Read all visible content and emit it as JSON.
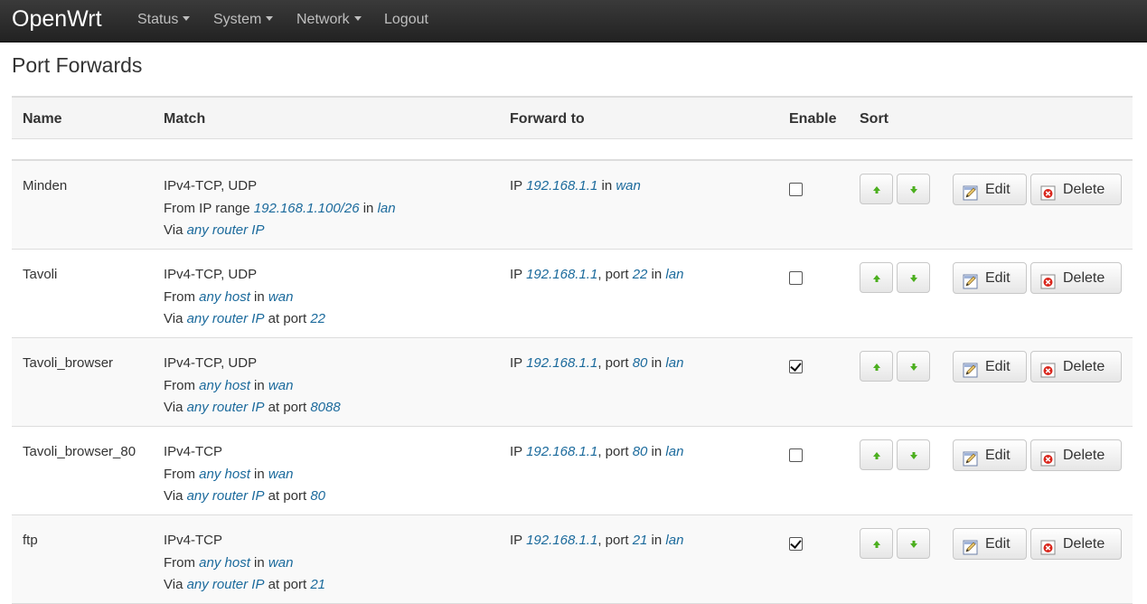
{
  "nav": {
    "brand": "OpenWrt",
    "menus": [
      "Status",
      "System",
      "Network"
    ],
    "logout": "Logout"
  },
  "page": {
    "title": "Port Forwards"
  },
  "table": {
    "headers": {
      "name": "Name",
      "match": "Match",
      "forward": "Forward to",
      "enable": "Enable",
      "sort": "Sort"
    },
    "actions": {
      "edit": "Edit",
      "delete": "Delete"
    },
    "rows": [
      {
        "name": "Minden",
        "match": [
          [
            {
              "t": "IPv4-TCP, UDP"
            }
          ],
          [
            {
              "t": "From IP range "
            },
            {
              "t": "192.168.1.100/26",
              "v": true
            },
            {
              "t": " in "
            },
            {
              "t": "lan",
              "v": true
            }
          ],
          [
            {
              "t": "Via "
            },
            {
              "t": "any router IP",
              "v": true
            }
          ]
        ],
        "forward": [
          [
            {
              "t": "IP "
            },
            {
              "t": "192.168.1.1",
              "v": true
            },
            {
              "t": " in "
            },
            {
              "t": "wan",
              "v": true
            }
          ]
        ],
        "enabled": false
      },
      {
        "name": "Tavoli",
        "match": [
          [
            {
              "t": "IPv4-TCP, UDP"
            }
          ],
          [
            {
              "t": "From "
            },
            {
              "t": "any host",
              "v": true
            },
            {
              "t": " in "
            },
            {
              "t": "wan",
              "v": true
            }
          ],
          [
            {
              "t": "Via "
            },
            {
              "t": "any router IP",
              "v": true
            },
            {
              "t": " at port "
            },
            {
              "t": "22",
              "v": true
            }
          ]
        ],
        "forward": [
          [
            {
              "t": "IP "
            },
            {
              "t": "192.168.1.1",
              "v": true
            },
            {
              "t": ", port "
            },
            {
              "t": "22",
              "v": true
            },
            {
              "t": " in "
            },
            {
              "t": "lan",
              "v": true
            }
          ]
        ],
        "enabled": false
      },
      {
        "name": "Tavoli_browser",
        "match": [
          [
            {
              "t": "IPv4-TCP, UDP"
            }
          ],
          [
            {
              "t": "From "
            },
            {
              "t": "any host",
              "v": true
            },
            {
              "t": " in "
            },
            {
              "t": "wan",
              "v": true
            }
          ],
          [
            {
              "t": "Via "
            },
            {
              "t": "any router IP",
              "v": true
            },
            {
              "t": " at port "
            },
            {
              "t": "8088",
              "v": true
            }
          ]
        ],
        "forward": [
          [
            {
              "t": "IP "
            },
            {
              "t": "192.168.1.1",
              "v": true
            },
            {
              "t": ", port "
            },
            {
              "t": "80",
              "v": true
            },
            {
              "t": " in "
            },
            {
              "t": "lan",
              "v": true
            }
          ]
        ],
        "enabled": true
      },
      {
        "name": "Tavoli_browser_80",
        "match": [
          [
            {
              "t": "IPv4-TCP"
            }
          ],
          [
            {
              "t": "From "
            },
            {
              "t": "any host",
              "v": true
            },
            {
              "t": " in "
            },
            {
              "t": "wan",
              "v": true
            }
          ],
          [
            {
              "t": "Via "
            },
            {
              "t": "any router IP",
              "v": true
            },
            {
              "t": " at port "
            },
            {
              "t": "80",
              "v": true
            }
          ]
        ],
        "forward": [
          [
            {
              "t": "IP "
            },
            {
              "t": "192.168.1.1",
              "v": true
            },
            {
              "t": ", port "
            },
            {
              "t": "80",
              "v": true
            },
            {
              "t": " in "
            },
            {
              "t": "lan",
              "v": true
            }
          ]
        ],
        "enabled": false
      },
      {
        "name": "ftp",
        "match": [
          [
            {
              "t": "IPv4-TCP"
            }
          ],
          [
            {
              "t": "From "
            },
            {
              "t": "any host",
              "v": true
            },
            {
              "t": " in "
            },
            {
              "t": "wan",
              "v": true
            }
          ],
          [
            {
              "t": "Via "
            },
            {
              "t": "any router IP",
              "v": true
            },
            {
              "t": " at port "
            },
            {
              "t": "21",
              "v": true
            }
          ]
        ],
        "forward": [
          [
            {
              "t": "IP "
            },
            {
              "t": "192.168.1.1",
              "v": true
            },
            {
              "t": ", port "
            },
            {
              "t": "21",
              "v": true
            },
            {
              "t": " in "
            },
            {
              "t": "lan",
              "v": true
            }
          ]
        ],
        "enabled": true
      }
    ]
  },
  "colors": {
    "navbar": "#222222",
    "link_value": "#1b6a9c",
    "row_odd": "#f9f9f9",
    "arrow_green": "#4caf1f",
    "delete_red": "#d9261c"
  },
  "icons": {
    "up": "arrow-up-icon",
    "down": "arrow-down-icon",
    "edit": "edit-icon",
    "delete": "delete-icon"
  }
}
